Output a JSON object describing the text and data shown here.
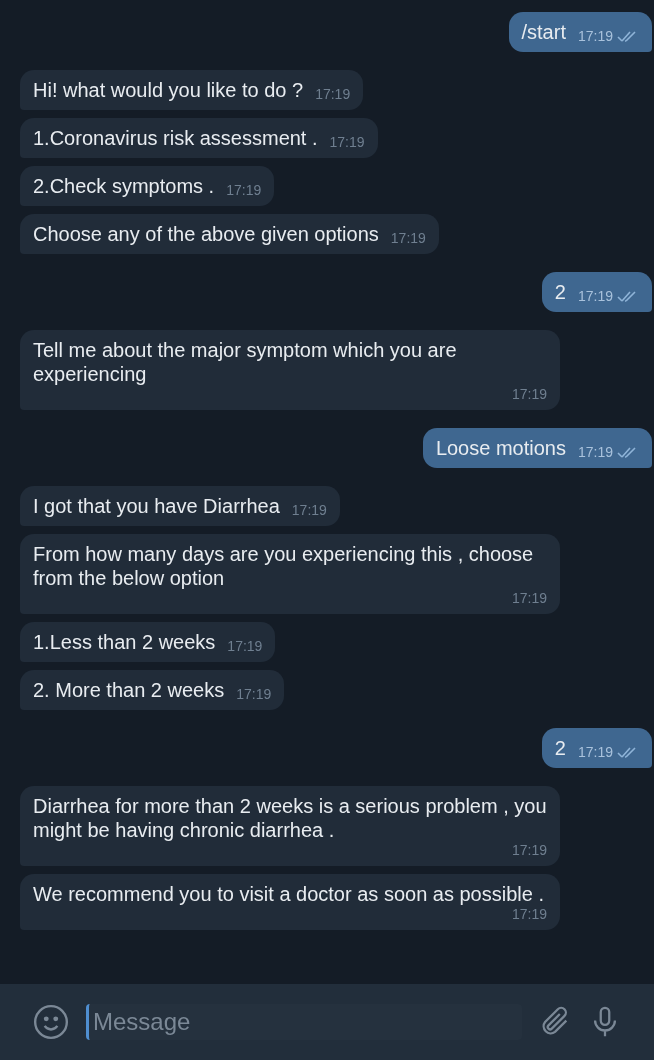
{
  "messages": [
    {
      "kind": "out",
      "text": "/start",
      "time": "17:19",
      "read": true
    },
    {
      "kind": "in",
      "text": "Hi! what would you like to do ?",
      "time": "17:19"
    },
    {
      "kind": "in",
      "text": "1.Coronavirus risk assessment .",
      "time": "17:19"
    },
    {
      "kind": "in",
      "text": "2.Check symptoms .",
      "time": "17:19"
    },
    {
      "kind": "in",
      "text": "Choose any of the above  given options",
      "time": "17:19"
    },
    {
      "kind": "out",
      "text": "2",
      "time": "17:19",
      "read": true
    },
    {
      "kind": "in",
      "text": "Tell me about the major symptom which you are experiencing",
      "time": "17:19"
    },
    {
      "kind": "out",
      "text": "Loose motions",
      "time": "17:19",
      "read": true
    },
    {
      "kind": "in",
      "text": "I got that you have Diarrhea",
      "time": "17:19"
    },
    {
      "kind": "in",
      "text": "From how many days are you experiencing this , choose from the below option",
      "time": "17:19"
    },
    {
      "kind": "in",
      "text": "1.Less than 2 weeks",
      "time": "17:19"
    },
    {
      "kind": "in",
      "text": "2. More than 2 weeks",
      "time": "17:19"
    },
    {
      "kind": "out",
      "text": "2",
      "time": "17:19",
      "read": true
    },
    {
      "kind": "in",
      "text": "Diarrhea for more than 2 weeks  is a  serious problem , you might be having chronic diarrhea .",
      "time": "17:19"
    },
    {
      "kind": "in",
      "text": "We recommend you to visit a doctor as soon as possible .",
      "time": "17:19"
    }
  ],
  "composer": {
    "placeholder": "Message"
  }
}
